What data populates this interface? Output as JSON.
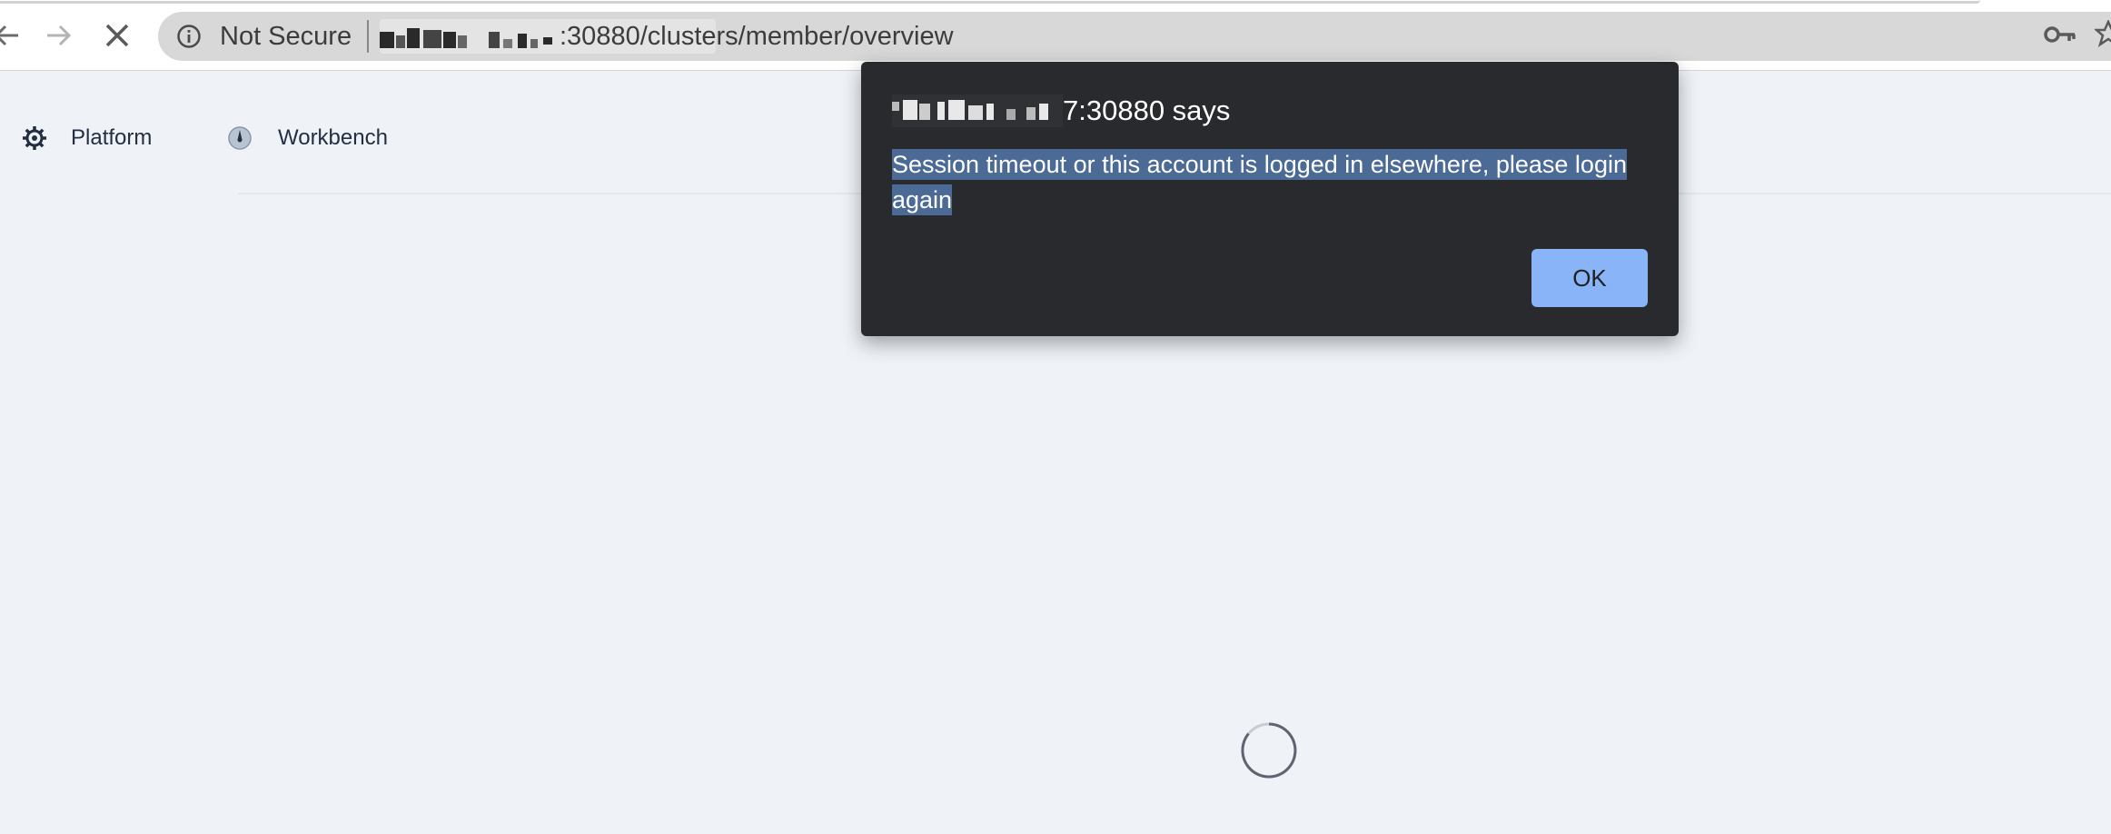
{
  "browser": {
    "security_label": "Not Secure",
    "url_suffix": ":30880/clusters/member/overview",
    "icons": {
      "back": "back-arrow-icon",
      "forward": "forward-arrow-icon",
      "stop": "stop-icon",
      "info": "info-icon",
      "key": "key-icon",
      "bookmark": "star-icon"
    }
  },
  "app_nav": {
    "items": [
      {
        "label": "Platform",
        "icon": "gear-icon"
      },
      {
        "label": "Workbench",
        "icon": "compass-icon"
      }
    ]
  },
  "dialog": {
    "title_suffix": "7:30880 says",
    "message": "Session timeout or this account is logged in elsewhere, please login again",
    "ok_label": "OK",
    "colors": {
      "background": "#292a2d",
      "selection": "#4b6a95",
      "button": "#8ab4f8"
    }
  },
  "loading": {
    "icon": "loading-spinner-icon"
  }
}
